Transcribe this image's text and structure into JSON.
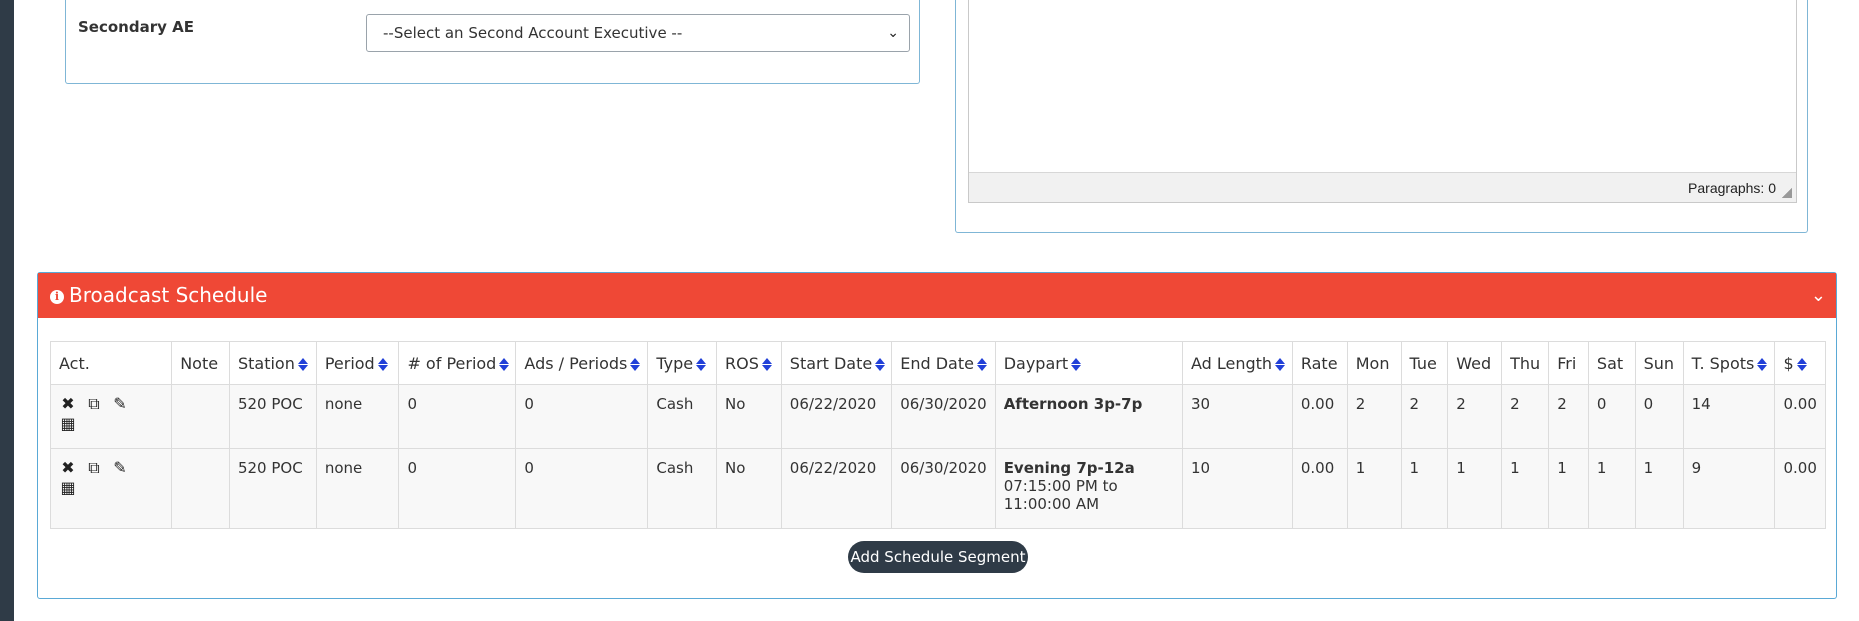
{
  "secondary_ae": {
    "label": "Secondary AE",
    "select_value": "--Select an Second Account Executive --"
  },
  "editor": {
    "status": "Paragraphs: 0"
  },
  "broadcast_schedule": {
    "title": "Broadcast Schedule",
    "columns": [
      "Act.",
      "Note",
      "Station",
      "Period",
      "# of Period",
      "Ads / Periods",
      "Type",
      "ROS",
      "Start Date",
      "End Date",
      "Daypart",
      "Ad Length",
      "Rate",
      "Mon",
      "Tue",
      "Wed",
      "Thu",
      "Fri",
      "Sat",
      "Sun",
      "T. Spots",
      "$"
    ],
    "rows": [
      {
        "note": "",
        "station": "520 POC",
        "period": "none",
        "num_period": "0",
        "ads_periods": "0",
        "type": "Cash",
        "ros": "No",
        "start": "06/22/2020",
        "end": "06/30/2020",
        "daypart": "Afternoon 3p-7p",
        "daypart_time": "",
        "ad_length": "30",
        "rate": "0.00",
        "mon": "2",
        "tue": "2",
        "wed": "2",
        "thu": "2",
        "fri": "2",
        "sat": "0",
        "sun": "0",
        "t_spots": "14",
        "amount": "0.00"
      },
      {
        "note": "",
        "station": "520 POC",
        "period": "none",
        "num_period": "0",
        "ads_periods": "0",
        "type": "Cash",
        "ros": "No",
        "start": "06/22/2020",
        "end": "06/30/2020",
        "daypart": "Evening 7p-12a",
        "daypart_time": "07:15:00 PM to 11:00:00 AM",
        "ad_length": "10",
        "rate": "0.00",
        "mon": "1",
        "tue": "1",
        "wed": "1",
        "thu": "1",
        "fri": "1",
        "sat": "1",
        "sun": "1",
        "t_spots": "9",
        "amount": "0.00"
      }
    ],
    "add_button": "Add Schedule Segment"
  },
  "colors": {
    "header_red": "#ef4836",
    "sort_arrow_blue": "#2140d8",
    "button_dark": "#2f3b47",
    "panel_border": "#5aa9d6"
  }
}
